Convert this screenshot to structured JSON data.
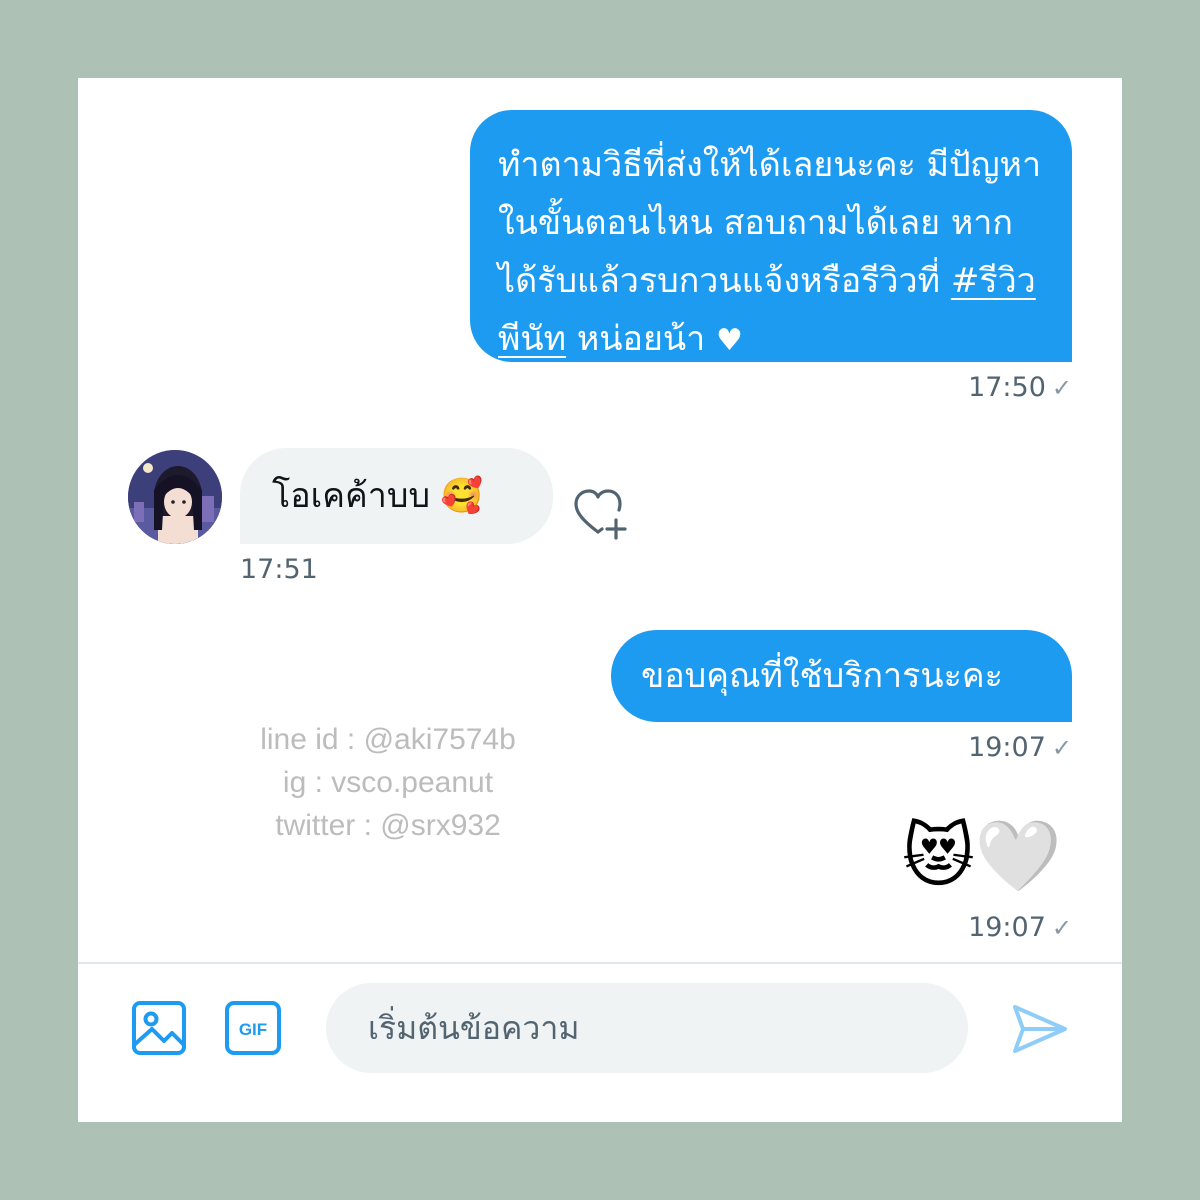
{
  "colors": {
    "frame": "#adc1b5",
    "accent": "#1d9bf0",
    "incoming_bubble": "#eff3f4",
    "timestamp": "#536471",
    "watermark": "#bcbcbc"
  },
  "messages": [
    {
      "direction": "outgoing",
      "text_before": "ทำตามวิธีที่ส่งให้ได้เลยนะคะ มีปัญหาในขั้นตอนไหน สอบถามได้เลย หากได้รับแล้วรบกวนแจ้งหรือรีวิวที่ ",
      "hashtag": "#รีวิวพีนัท",
      "text_after": " หน่อยน้า ",
      "heart": "♥",
      "time": "17:50",
      "check": "✓"
    },
    {
      "direction": "incoming",
      "text": "โอเคค้าบบ 🥰",
      "time": "17:51",
      "avatar_icon": "avatar-anime-girl",
      "reaction_icon": "heart-plus-icon"
    },
    {
      "direction": "outgoing",
      "text": "ขอบคุณที่ใช้บริการนะคะ",
      "time": "19:07",
      "check": "✓"
    },
    {
      "direction": "outgoing",
      "text": "😻🤍",
      "time": "19:07",
      "check": "✓"
    }
  ],
  "watermark": {
    "line1": "line id : @aki7574b",
    "line2": "ig : vsco.peanut",
    "line3": "twitter : @srx932"
  },
  "composer": {
    "placeholder": "เริ่มต้นข้อความ",
    "image_icon": "image-icon",
    "gif_label": "GIF",
    "send_icon": "send-icon"
  }
}
